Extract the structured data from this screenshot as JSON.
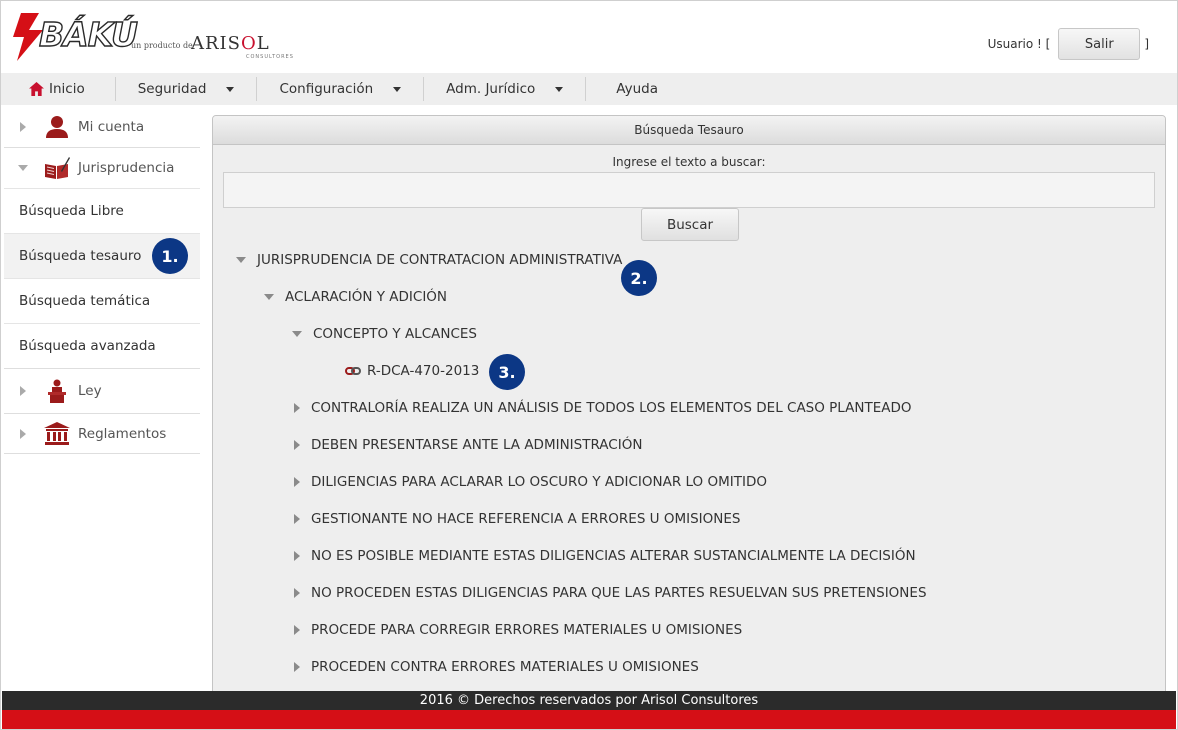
{
  "brand": {
    "name": "BÁKÚ",
    "sub": "un producto de",
    "company_prefix": "ARIS",
    "company_o": "O",
    "company_suffix": "L",
    "company_tag": "CONSULTORES"
  },
  "user": {
    "label": "Usuario ! [",
    "logout_label": "Salir",
    "close_bracket": "]"
  },
  "nav": {
    "home": "Inicio",
    "security": "Seguridad",
    "config": "Configuración",
    "legal": "Adm. Jurídico",
    "help": "Ayuda"
  },
  "sidebar": {
    "my_account": "Mi cuenta",
    "jurisprudence": "Jurisprudencia",
    "links": [
      "Búsqueda Libre",
      "Búsqueda tesauro",
      "Búsqueda temática",
      "Búsqueda avanzada"
    ],
    "law": "Ley",
    "regulations": "Reglamentos"
  },
  "panel": {
    "title": "Búsqueda Tesauro",
    "search_label": "Ingrese el texto a buscar:",
    "search_value": "",
    "search_button": "Buscar"
  },
  "tree": {
    "root": "JURISPRUDENCIA DE CONTRATACION ADMINISTRATIVA",
    "level1": "ACLARACIÓN Y ADICIÓN",
    "level2": "CONCEPTO Y ALCANCES",
    "leaf": "R-DCA-470-2013",
    "siblings": [
      "CONTRALORÍA REALIZA UN ANÁLISIS DE TODOS LOS ELEMENTOS DEL CASO PLANTEADO",
      "DEBEN PRESENTARSE ANTE LA ADMINISTRACIÓN",
      "DILIGENCIAS PARA ACLARAR LO OSCURO Y ADICIONAR LO OMITIDO",
      "GESTIONANTE NO HACE REFERENCIA A ERRORES U OMISIONES",
      "NO ES POSIBLE MEDIANTE ESTAS DILIGENCIAS ALTERAR SUSTANCIALMENTE LA DECISIÓN",
      "NO PROCEDEN ESTAS DILIGENCIAS PARA QUE LAS PARTES RESUELVAN SUS PRETENSIONES",
      "PROCEDE PARA CORREGIR ERRORES MATERIALES U OMISIONES",
      "PROCEDEN CONTRA ERRORES MATERIALES U OMISIONES"
    ]
  },
  "badges": [
    "1.",
    "2.",
    "3."
  ],
  "footer": {
    "text": "2016 © Derechos reservados por Arisol Consultores"
  },
  "colors": {
    "brand_red": "#d50f16",
    "badge_blue": "#0c3785",
    "footer_dark": "#2b2b2b",
    "icon_red": "#9b1b1b"
  }
}
